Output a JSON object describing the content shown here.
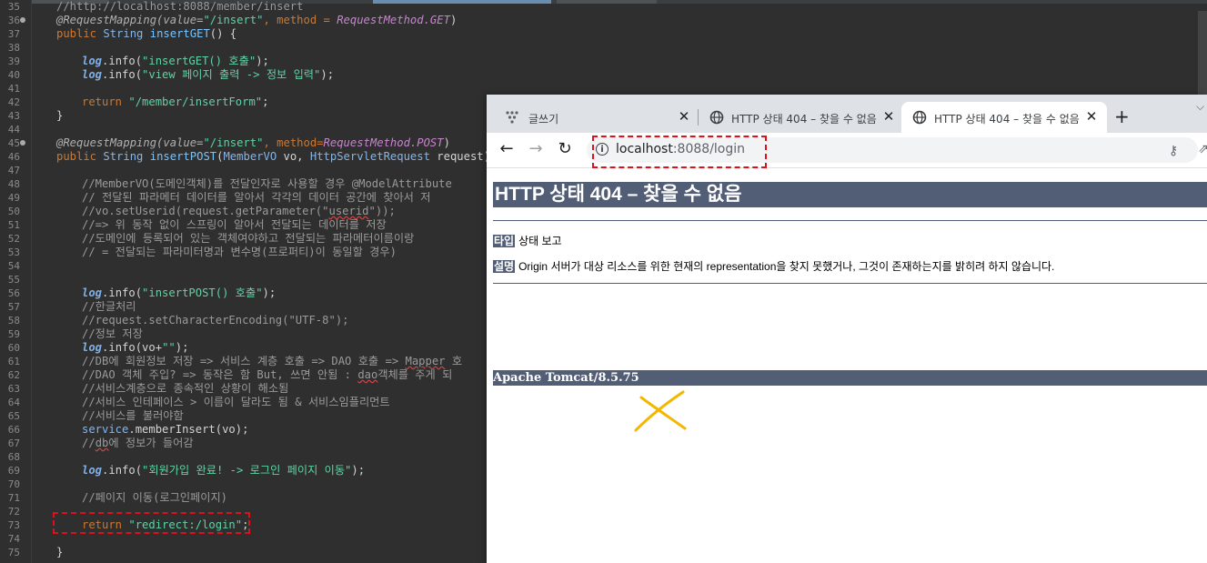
{
  "editor": {
    "line_numbers": [
      "35",
      "36",
      "37",
      "38",
      "39",
      "40",
      "41",
      "42",
      "43",
      "44",
      "45",
      "46",
      "47",
      "48",
      "49",
      "50",
      "51",
      "52",
      "53",
      "54",
      "55",
      "56",
      "57",
      "58",
      "59",
      "60",
      "61",
      "62",
      "63",
      "64",
      "65",
      "66",
      "67",
      "68",
      "69",
      "70",
      "71",
      "72",
      "73",
      "74",
      "75"
    ]
  },
  "code": {
    "l35": "//http://localhost:8088/member/insert",
    "l36a": "@RequestMapping(value=",
    "l36b": "\"/insert\"",
    "l36c": ", method = ",
    "l36d": "RequestMethod.GET",
    "l36e": ")",
    "l37a": "public",
    "l37b": "String",
    "l37c": "insertGET",
    "l37d": "() {",
    "l39a": "log",
    "l39b": ".info(",
    "l39c": "\"insertGET() 호출\"",
    "l39d": ");",
    "l40a": "log",
    "l40b": ".info(",
    "l40c": "\"view 페이지 출력 -> 정보 입력\"",
    "l40d": ");",
    "l42a": "return",
    "l42b": "\"/member/insertForm\"",
    "l42c": ";",
    "l43": "}",
    "l45a": "@RequestMapping(value=",
    "l45b": "\"/insert\"",
    "l45c": ", method=",
    "l45d": "RequestMethod.POST",
    "l45e": ")",
    "l46a": "public",
    "l46b": "String",
    "l46c": "insertPOST",
    "l46d": "(",
    "l46e": "MemberVO",
    "l46f": " vo, ",
    "l46g": "HttpServletRequest",
    "l46h": " request) th",
    "l48": "//MemberVO(도메인객체)를 전달인자로 사용할 경우 @ModelAttribute",
    "l49": "// 전달된 파라메터 데이터를 알아서 각각의 데이터 공간에 찾아서 저",
    "l50a": "//vo.setUserid(request.getParameter(\"",
    "l50b": "userid",
    "l50c": "\"));",
    "l51": "//=> 위 동작 없이 스프링이 알아서 전달되는 데이터를 저장",
    "l52": "//도메인에 등록되어 있는 객체여야하고 전달되는 파라메터이름이랑",
    "l53": "// = 전달되는 파라미터명과 변수명(프로퍼티)이 동일할 경우)",
    "l56a": "log",
    "l56b": ".info(",
    "l56c": "\"insertPOST() 호출\"",
    "l56d": ");",
    "l57": "//한글처리",
    "l58": "//request.setCharacterEncoding(\"UTF-8\");",
    "l59": "//정보 저장",
    "l60a": "log",
    "l60b": ".info(vo+",
    "l60c": "\"\"",
    "l60d": ");",
    "l61a": "//DB에 회원정보 저장 => 서비스 계층 호출 => DAO 호출 => ",
    "l61b": "Mapper",
    "l61c": " 호",
    "l62a": "//DAO 객체 주입? => 동작은 함 But, 쓰면 안됨 : ",
    "l62b": "dao",
    "l62c": "객체를 주게 되",
    "l63": "//서비스계층으로 종속적인 상황이 해소됨",
    "l64": "//서비스 인테페이스 > 이름이 달라도 됨 & 서비스임플리먼트",
    "l65": "//서비스를 불러야함",
    "l66a": "service",
    "l66b": ".memberInsert(vo);",
    "l67a": "//",
    "l67b": "db",
    "l67c": "에 정보가 들어감",
    "l69a": "log",
    "l69b": ".info(",
    "l69c": "\"회원가입 완료! -> 로그인 페이지 이동\"",
    "l69d": ");",
    "l71": "//페이지 이동(로그인페이지)",
    "l73a": "return",
    "l73b": "\"redirect:/login\"",
    "l73c": ";",
    "l75": "}"
  },
  "browser": {
    "tabs": [
      {
        "title": "글쓰기",
        "close": "✕",
        "icon": "tree-dots-icon"
      },
      {
        "title": "HTTP 상태 404 – 찾을 수 없음",
        "close": "✕",
        "icon": "globe-icon"
      },
      {
        "title": "HTTP 상태 404 – 찾을 수 없음",
        "close": "✕",
        "icon": "globe-icon",
        "active": true
      }
    ],
    "new_tab": "+",
    "back": "←",
    "forward": "→",
    "reload": "↻",
    "url_host": "localhost",
    "url_port_path": ":8088/login",
    "info_glyph": "i"
  },
  "page": {
    "title": "HTTP 상태 404 – 찾을 수 없음",
    "type_label": "타입",
    "type_value": "상태 보고",
    "desc_label": "설명",
    "desc_value": "Origin 서버가 대상 리소스를 위한 현재의 representation을 찾지 못했거나, 그것이 존재하는지를 밝히려 하지 않습니다.",
    "footer": "Apache Tomcat/8.5.75"
  },
  "colors": {
    "tomcat_header": "#525d76",
    "highlight_dash": "#e0101a",
    "annotation_stroke": "#f2b800"
  }
}
